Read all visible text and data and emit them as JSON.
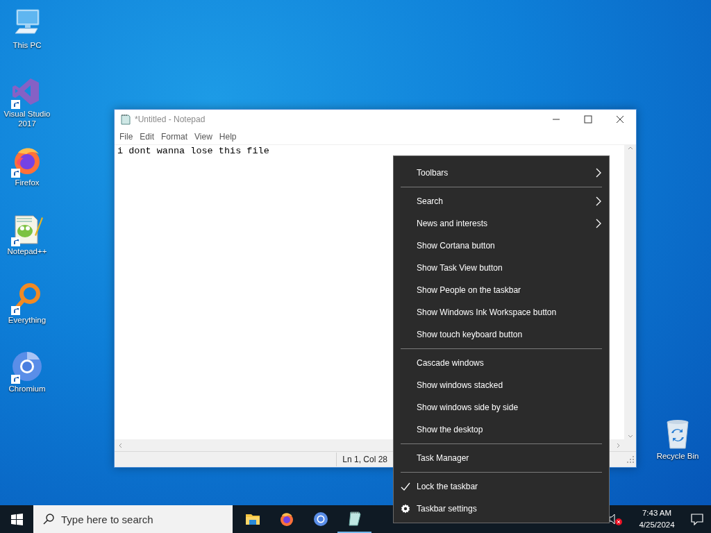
{
  "desktop_icons": [
    {
      "label": "This PC",
      "kind": "pc",
      "shortcut": false
    },
    {
      "label": "Visual Studio 2017",
      "kind": "vs",
      "shortcut": true
    },
    {
      "label": "Firefox",
      "kind": "firefox",
      "shortcut": true
    },
    {
      "label": "Notepad++",
      "kind": "npp",
      "shortcut": true
    },
    {
      "label": "Everything",
      "kind": "everything",
      "shortcut": true
    },
    {
      "label": "Chromium",
      "kind": "chromium",
      "shortcut": true
    }
  ],
  "recycle_bin": {
    "label": "Recycle Bin"
  },
  "notepad": {
    "title": "*Untitled - Notepad",
    "menu": [
      "File",
      "Edit",
      "Format",
      "View",
      "Help"
    ],
    "text": "i dont wanna lose this file",
    "status": "Ln 1, Col 28"
  },
  "context_menu": {
    "groups": [
      [
        {
          "label": "Toolbars",
          "kind": "submenu"
        }
      ],
      [
        {
          "label": "Search",
          "kind": "submenu"
        },
        {
          "label": "News and interests",
          "kind": "submenu"
        },
        {
          "label": "Show Cortana button",
          "kind": "plain"
        },
        {
          "label": "Show Task View button",
          "kind": "plain"
        },
        {
          "label": "Show People on the taskbar",
          "kind": "plain"
        },
        {
          "label": "Show Windows Ink Workspace button",
          "kind": "plain"
        },
        {
          "label": "Show touch keyboard button",
          "kind": "plain"
        }
      ],
      [
        {
          "label": "Cascade windows",
          "kind": "plain"
        },
        {
          "label": "Show windows stacked",
          "kind": "plain"
        },
        {
          "label": "Show windows side by side",
          "kind": "plain"
        },
        {
          "label": "Show the desktop",
          "kind": "plain"
        }
      ],
      [
        {
          "label": "Task Manager",
          "kind": "plain"
        }
      ],
      [
        {
          "label": "Lock the taskbar",
          "kind": "check",
          "checked": true
        },
        {
          "label": "Taskbar settings",
          "kind": "settings"
        }
      ]
    ]
  },
  "taskbar": {
    "search_placeholder": "Type here to search",
    "apps": [
      {
        "kind": "explorer",
        "running": false
      },
      {
        "kind": "firefox",
        "running": false
      },
      {
        "kind": "chromium",
        "running": false
      },
      {
        "kind": "notepad",
        "running": true
      }
    ],
    "time": "7:43 AM",
    "date": "4/25/2024"
  }
}
